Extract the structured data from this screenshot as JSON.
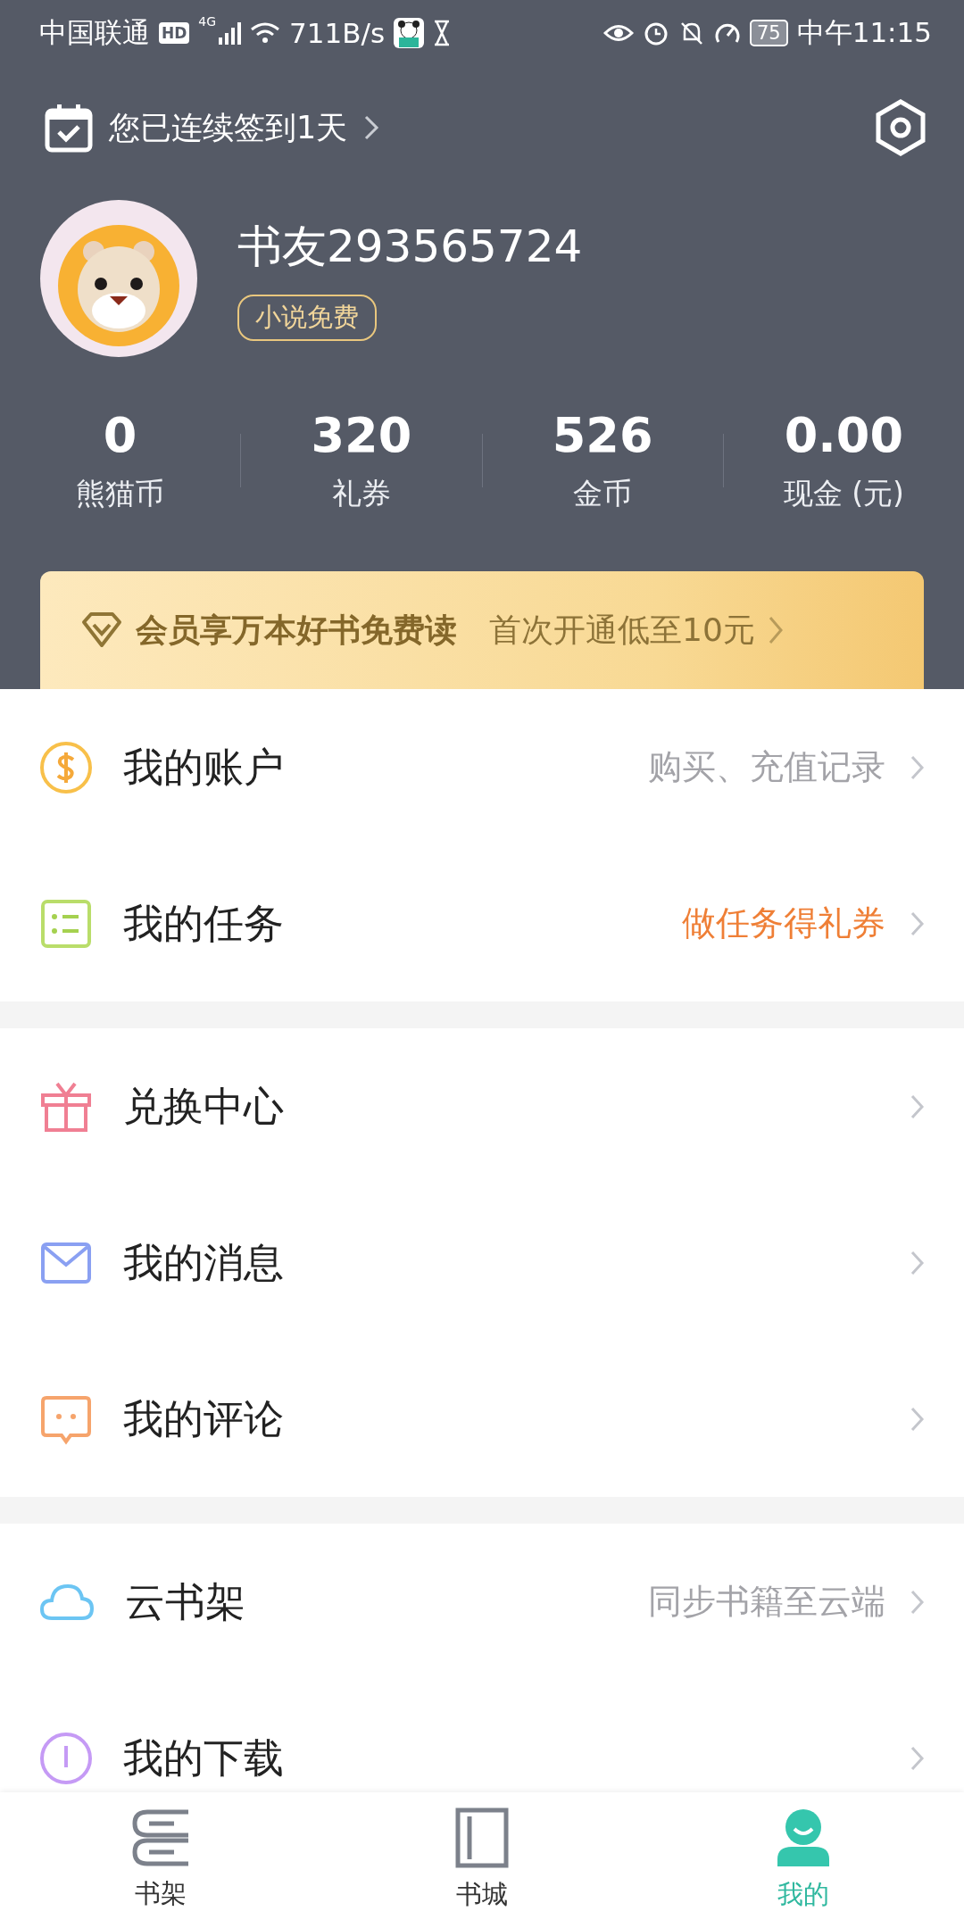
{
  "status_bar": {
    "carrier": "中国联通",
    "hd_badge": "HD",
    "network": "4G",
    "speed": "711B/s",
    "battery": "75",
    "time": "中午11:15"
  },
  "checkin": {
    "text": "您已连续签到1天"
  },
  "profile": {
    "name": "书友293565724",
    "badge": "小说免费"
  },
  "stats": [
    {
      "value": "0",
      "label": "熊猫币"
    },
    {
      "value": "320",
      "label": "礼券"
    },
    {
      "value": "526",
      "label": "金币"
    },
    {
      "value": "0.00",
      "label": "现金 (元)"
    }
  ],
  "vip_banner": {
    "title": "会员享万本好书免费读",
    "subtitle": "首次开通低至10元"
  },
  "menu_sections": [
    {
      "items": [
        {
          "label": "我的账户",
          "hint": "购买、充值记录",
          "highlighted": false
        },
        {
          "label": "我的任务",
          "hint": "做任务得礼券",
          "highlighted": true
        }
      ]
    },
    {
      "items": [
        {
          "label": "兑换中心"
        },
        {
          "label": "我的消息"
        },
        {
          "label": "我的评论"
        }
      ]
    },
    {
      "items": [
        {
          "label": "云书架",
          "hint": "同步书籍至云端",
          "highlighted": false
        },
        {
          "label": "我的下载"
        }
      ]
    }
  ],
  "tabs": [
    {
      "label": "书架",
      "selected": false
    },
    {
      "label": "书城",
      "selected": false
    },
    {
      "label": "我的",
      "selected": true
    }
  ]
}
